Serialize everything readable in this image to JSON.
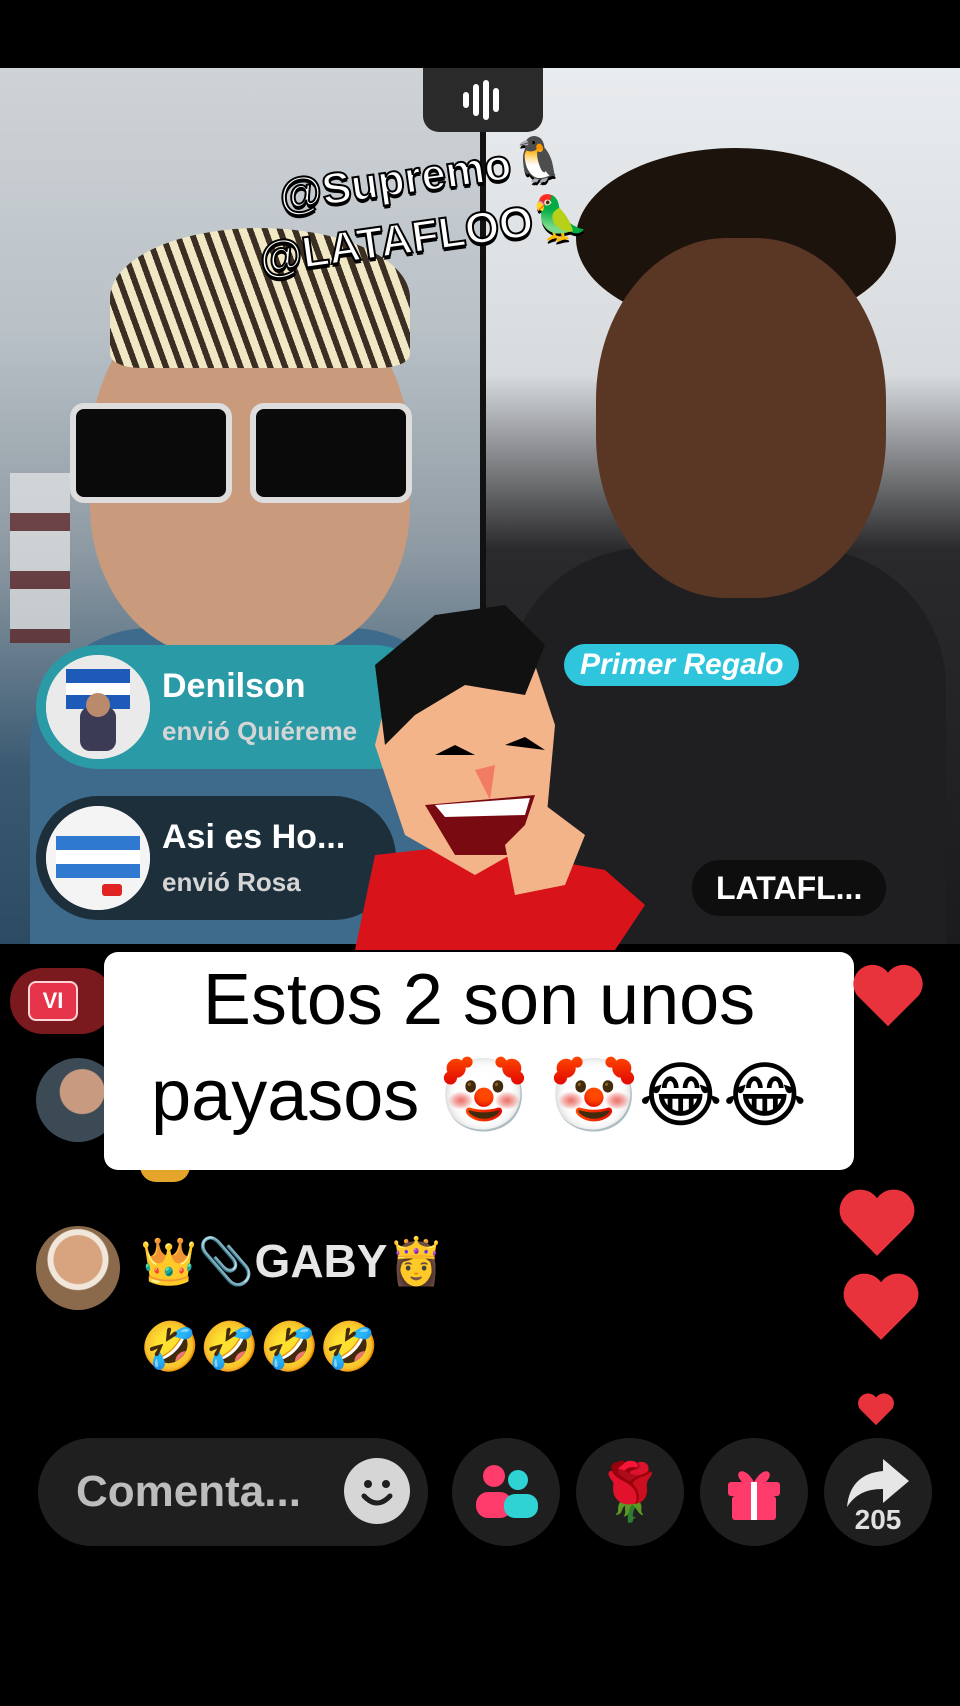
{
  "overlay": {
    "mention_1": "@Supremo🐧",
    "mention_2": "@LATAFLOO🦜"
  },
  "gifts": [
    {
      "name": "Denilson",
      "action": "envió Quiéreme"
    },
    {
      "name": "Asi es Ho...",
      "action": "envió Rosa"
    }
  ],
  "badges": {
    "first_gift": "Primer Regalo",
    "right_host": "LATAFL...",
    "vip": "VI"
  },
  "caption": {
    "line1": "Estos 2 son unos",
    "line2": "payasos 🤡 🤡😂😂"
  },
  "comments": [
    {
      "user": "👑📎GABY👸",
      "text": "🤣🤣🤣🤣"
    }
  ],
  "bottom": {
    "comment_placeholder": "Comenta...",
    "gift_rose": "🌹",
    "share_count": "205"
  },
  "colors": {
    "accent_cyan": "#2fc5dc",
    "heart_red": "#e8323c",
    "gift_pink": "#ff3b6b"
  }
}
